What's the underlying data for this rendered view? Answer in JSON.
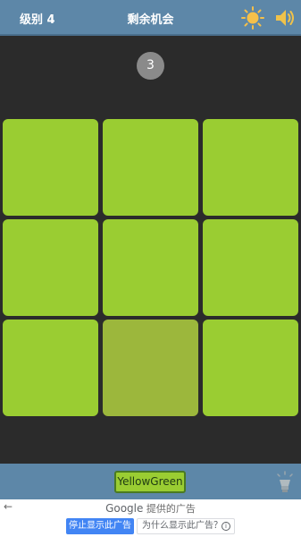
{
  "header": {
    "level": "级别 4",
    "chances_label": "剩余机会",
    "brightness_icon": "sun-icon",
    "sound_icon": "speaker-icon"
  },
  "counter": "3",
  "grid": {
    "rows": 3,
    "cols": 3,
    "base_color": "#9ACD32",
    "odd_color": "#9CB73C",
    "odd_index": 7
  },
  "footer": {
    "color_name": "YellowGreen",
    "hint_icon": "lightbulb-icon"
  },
  "ad": {
    "back_icon": "arrow-left-icon",
    "provider_prefix": "Google",
    "provider_suffix": "提供的广告",
    "stop_button": "停止显示此广告",
    "why_button": "为什么显示此广告？"
  }
}
